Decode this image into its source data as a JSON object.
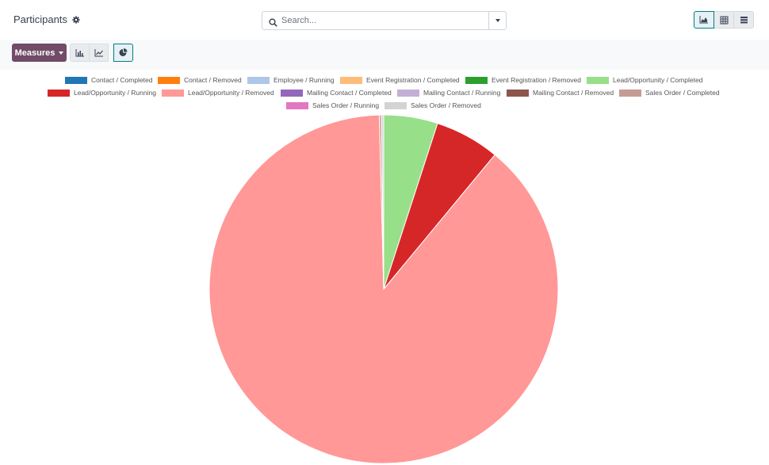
{
  "header": {
    "title": "Participants",
    "search_placeholder": "Search..."
  },
  "toolbar": {
    "measures_label": "Measures"
  },
  "view_switcher": {
    "active": "graph",
    "items": [
      "graph-view",
      "pivot-view",
      "list-view"
    ]
  },
  "chart_type_buttons": {
    "active": "pie",
    "items": [
      "bar",
      "line",
      "pie"
    ]
  },
  "colors": {
    "brand": "#714b67",
    "accent": "#017e84"
  },
  "chart_data": {
    "type": "pie",
    "legend_position": "top",
    "series": [
      {
        "name": "Contact / Completed",
        "color": "#1f77b4",
        "value": 0
      },
      {
        "name": "Contact / Removed",
        "color": "#ff7f0e",
        "value": 0
      },
      {
        "name": "Employee / Running",
        "color": "#aec7e8",
        "value": 0
      },
      {
        "name": "Event Registration / Completed",
        "color": "#ffbb78",
        "value": 0
      },
      {
        "name": "Event Registration / Removed",
        "color": "#2ca02c",
        "value": 0
      },
      {
        "name": "Lead/Opportunity / Completed",
        "color": "#98df8a",
        "value": 5
      },
      {
        "name": "Lead/Opportunity / Running",
        "color": "#d62728",
        "value": 6
      },
      {
        "name": "Lead/Opportunity / Removed",
        "color": "#ff9896",
        "value": 88.6
      },
      {
        "name": "Mailing Contact / Completed",
        "color": "#9467bd",
        "value": 0
      },
      {
        "name": "Mailing Contact / Running",
        "color": "#c5b0d5",
        "value": 0
      },
      {
        "name": "Mailing Contact / Removed",
        "color": "#8c564b",
        "value": 0
      },
      {
        "name": "Sales Order / Completed",
        "color": "#c49c94",
        "value": 0.2
      },
      {
        "name": "Sales Order / Running",
        "color": "#e377c2",
        "value": 0
      },
      {
        "name": "Sales Order / Removed",
        "color": "#d3d3d3",
        "value": 0.2
      }
    ]
  }
}
